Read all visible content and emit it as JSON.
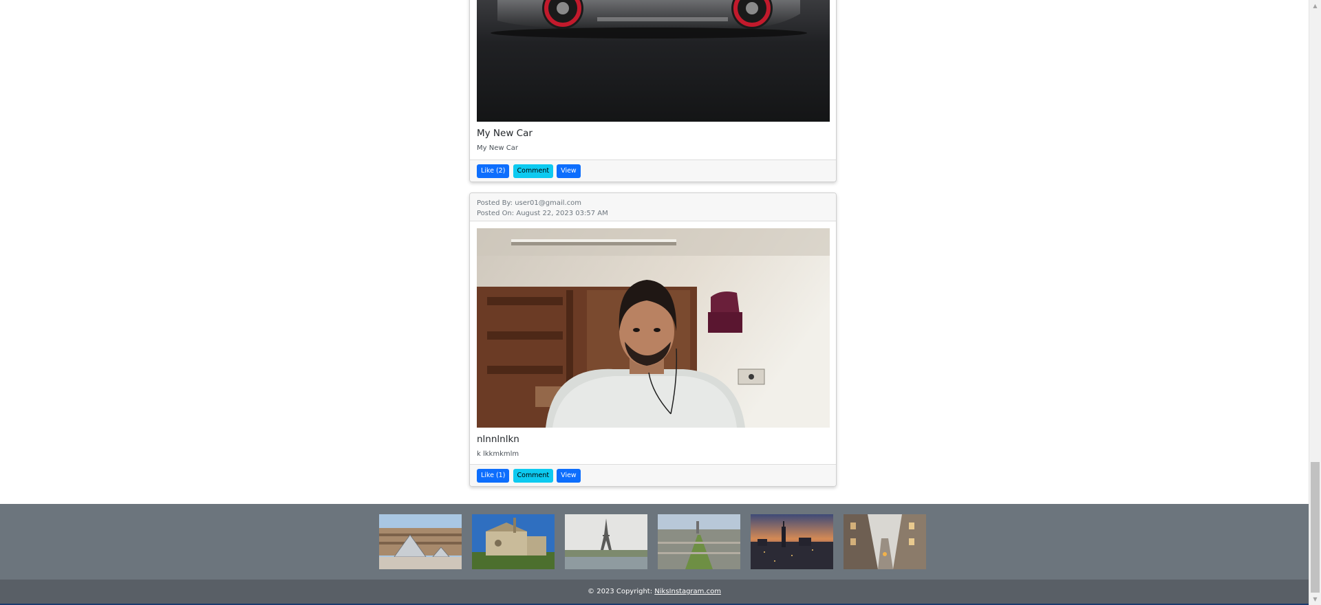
{
  "posts": [
    {
      "title": "My New Car",
      "caption": "My New Car",
      "like_label": "Like (2)",
      "comment_label": "Comment",
      "view_label": "View"
    },
    {
      "posted_by": "Posted By: user01@gmail.com",
      "posted_on": "Posted On: August 22, 2023 03:57 AM",
      "title": "nlnnlnlkn",
      "caption": "k lkkmkmlm",
      "like_label": "Like (1)",
      "comment_label": "Comment",
      "view_label": "View"
    }
  ],
  "footer": {
    "gallery_images": [
      "louvre-pyramid",
      "notre-dame",
      "eiffel-tower",
      "paris-aerial",
      "city-skyline-dusk",
      "paris-street"
    ],
    "copyright_prefix": "© 2023 Copyright: ",
    "copyright_link": "NiksInstagram.com"
  },
  "colors": {
    "primary": "#0d6efd",
    "info": "#0dcaf0",
    "footer_bg": "#6c757d",
    "copyright_bg": "#595f66"
  }
}
